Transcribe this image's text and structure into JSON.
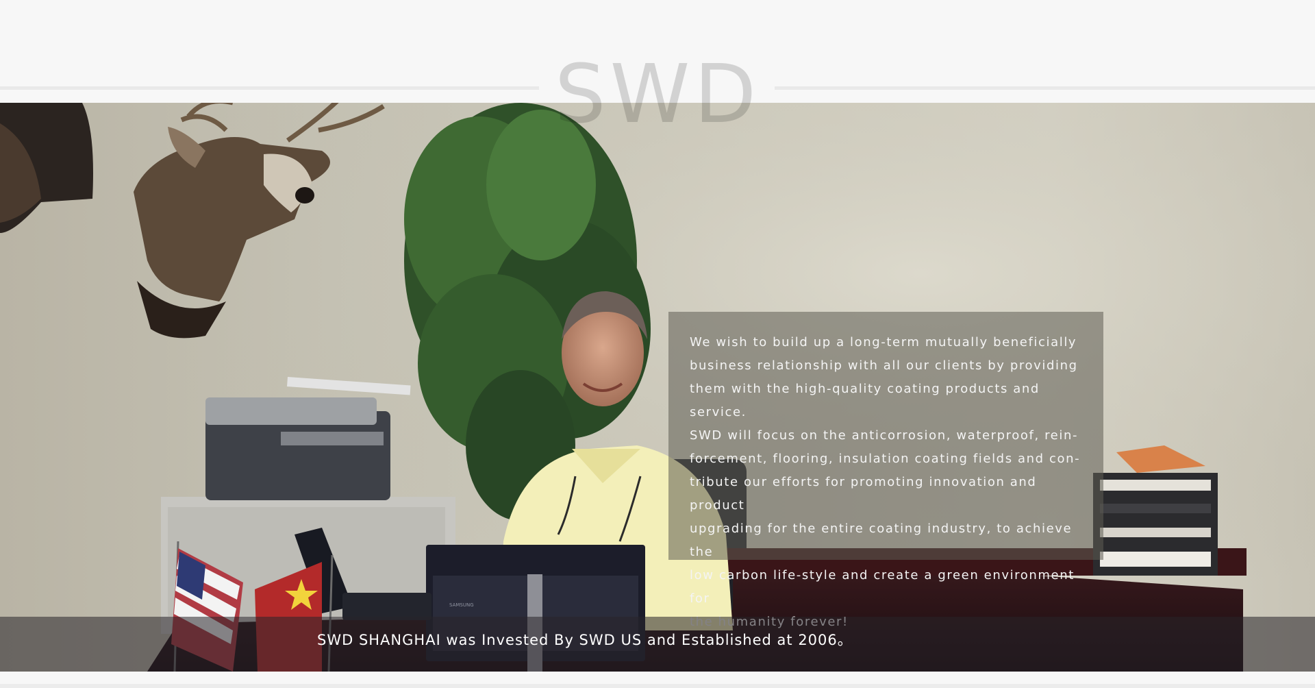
{
  "header": {
    "watermark_text": "SWD"
  },
  "hero": {
    "quote_lines": [
      "We wish to build up a long-term mutually beneficially",
      "business relationship with all our clients by providing",
      "them with the high-quality coating products and service.",
      "SWD will focus on the anticorrosion, waterproof, rein-",
      "forcement, flooring, insulation coating fields and con-",
      "tribute our efforts for promoting innovation and product",
      "upgrading for the entire coating industry, to achieve the",
      "low carbon life-style and create a green environment for",
      "the humanity forever!"
    ],
    "caption": "SWD SHANGHAI was Invested By SWD US and Established at 2006。",
    "monitor_brand": "SAMSUNG"
  },
  "colors": {
    "background": "#f7f7f7",
    "wall": "#c9c5b7",
    "overlay": "#5f5c54",
    "caption_bar": "#28242a",
    "text": "#ffffff"
  }
}
